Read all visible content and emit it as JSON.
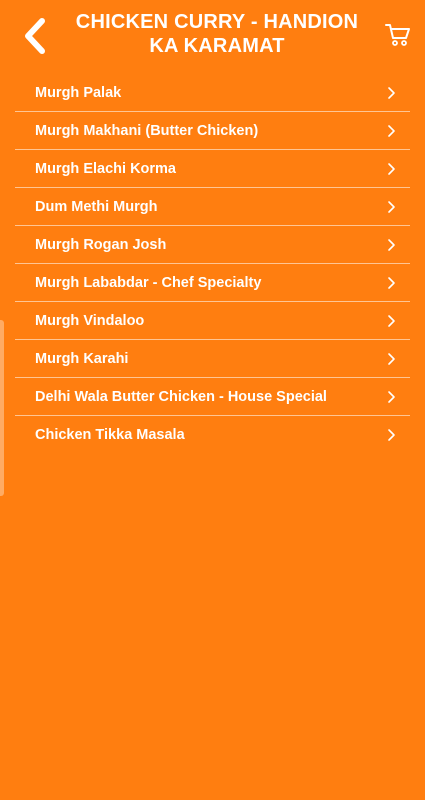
{
  "header": {
    "title": "CHICKEN CURRY - HANDION KA KARAMAT",
    "back_icon": "chevron-left-icon",
    "cart_icon": "cart-icon"
  },
  "menu": {
    "items": [
      {
        "label": "Murgh Palak"
      },
      {
        "label": "Murgh Makhani (Butter Chicken)"
      },
      {
        "label": "Murgh Elachi Korma"
      },
      {
        "label": "Dum Methi Murgh"
      },
      {
        "label": "Murgh Rogan Josh"
      },
      {
        "label": "Murgh Lababdar - Chef Specialty"
      },
      {
        "label": "Murgh Vindaloo"
      },
      {
        "label": "Murgh Karahi"
      },
      {
        "label": "Delhi Wala Butter Chicken - House Special"
      },
      {
        "label": "Chicken Tikka Masala"
      }
    ]
  },
  "colors": {
    "background": "#FF7E10",
    "text": "#FFFFFF"
  }
}
